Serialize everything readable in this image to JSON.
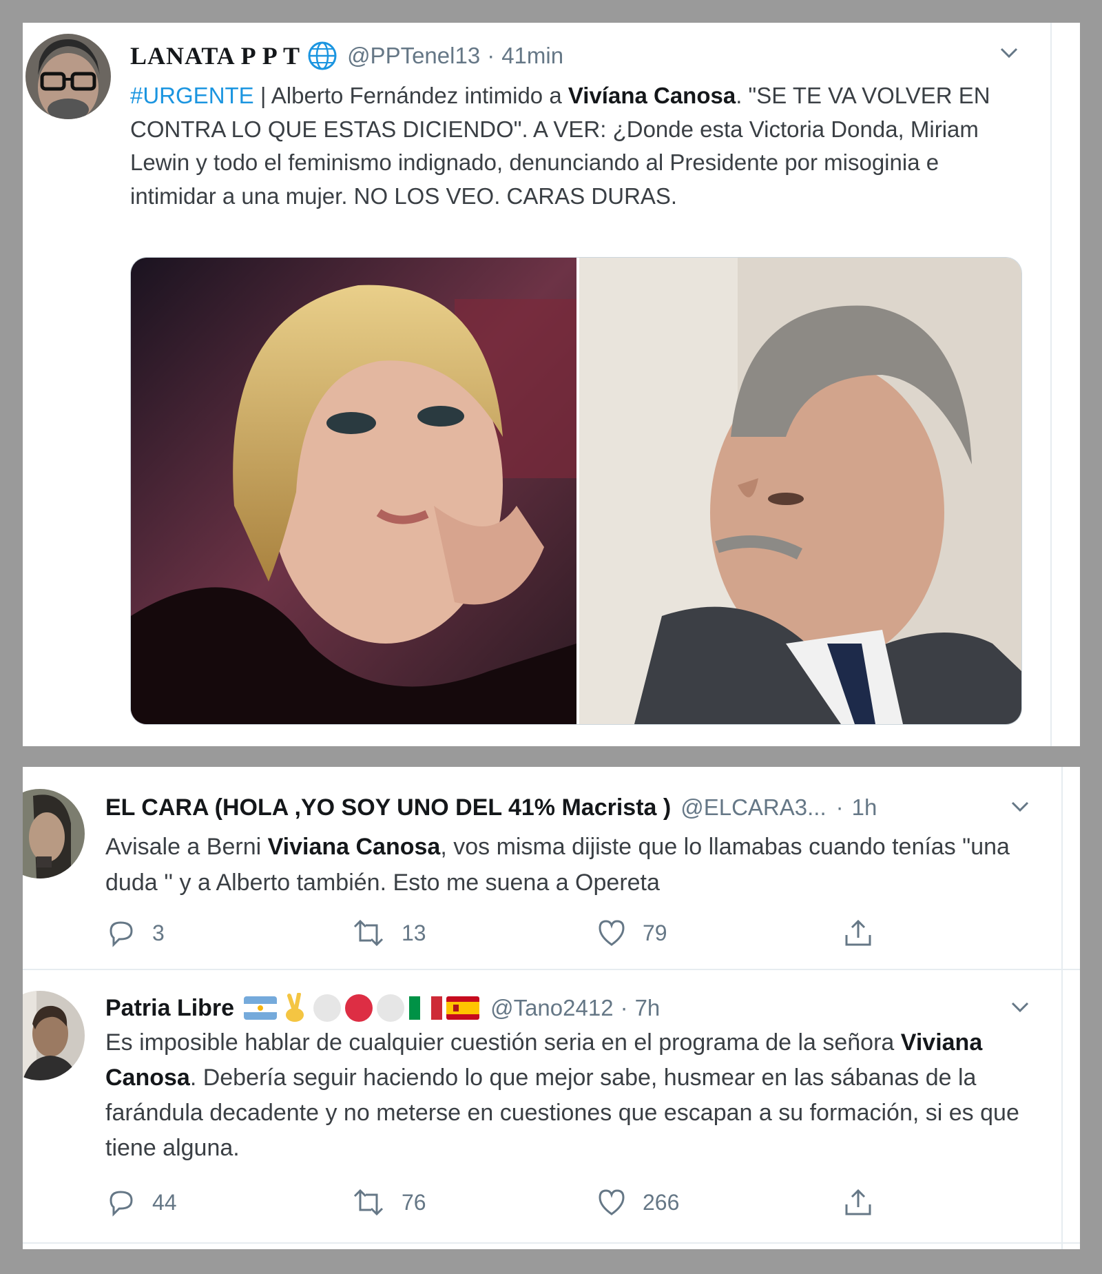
{
  "tweet1": {
    "name": "LANATA P P T",
    "name_icon": "globe-icon",
    "handle": "@PPTenel13",
    "sep": "·",
    "time": "41min",
    "hashtag": "#URGENTE",
    "text_a": " | Alberto Fernández intimido a ",
    "bold": "Vivíana Canosa",
    "text_b": ". \"SE TE VA VOLVER EN CONTRA LO QUE ESTAS DICIENDO\". A VER: ¿Donde esta Victoria Donda, Miriam Lewin y todo el feminismo indignado, denunciando al Presidente por misoginia e intimidar a una mujer. NO LOS VEO. CARAS DURAS."
  },
  "tweet2": {
    "name": "EL CARA (HOLA ,YO SOY UNO DEL 41% Macrista )",
    "handle": "@ELCARA3...",
    "sep": "·",
    "time": "1h",
    "text_a": "Avisale a Berni ",
    "bold": "Viviana Canosa",
    "text_b": ", vos misma dijiste que lo llamabas cuando tenías \"una duda '' y a Alberto también. Esto me suena a Opereta",
    "replies": "3",
    "retweets": "13",
    "likes": "79"
  },
  "tweet3": {
    "name": "Patria Libre",
    "name_emojis": [
      "argentina-flag-icon",
      "victory-hand-icon",
      "white-circle-icon",
      "red-circle-icon",
      "white-circle-icon",
      "italy-flag-icon",
      "spain-flag-icon"
    ],
    "handle": "@Tano2412",
    "sep": "·",
    "time": "7h",
    "text_a": "Es imposible hablar de cualquier cuestión seria en el programa de la señora ",
    "bold": "Viviana Canosa",
    "text_b": ". Debería seguir haciendo lo que mejor sabe, husmear en las sábanas de la farándula decadente y no meterse en cuestiones que escapan a su formación, si es que tiene alguna.",
    "replies": "44",
    "retweets": "76",
    "likes": "266"
  },
  "colors": {
    "frame": "#9a9a9a",
    "link": "#1b95e0",
    "muted": "#657786",
    "text": "#3a3f44"
  }
}
